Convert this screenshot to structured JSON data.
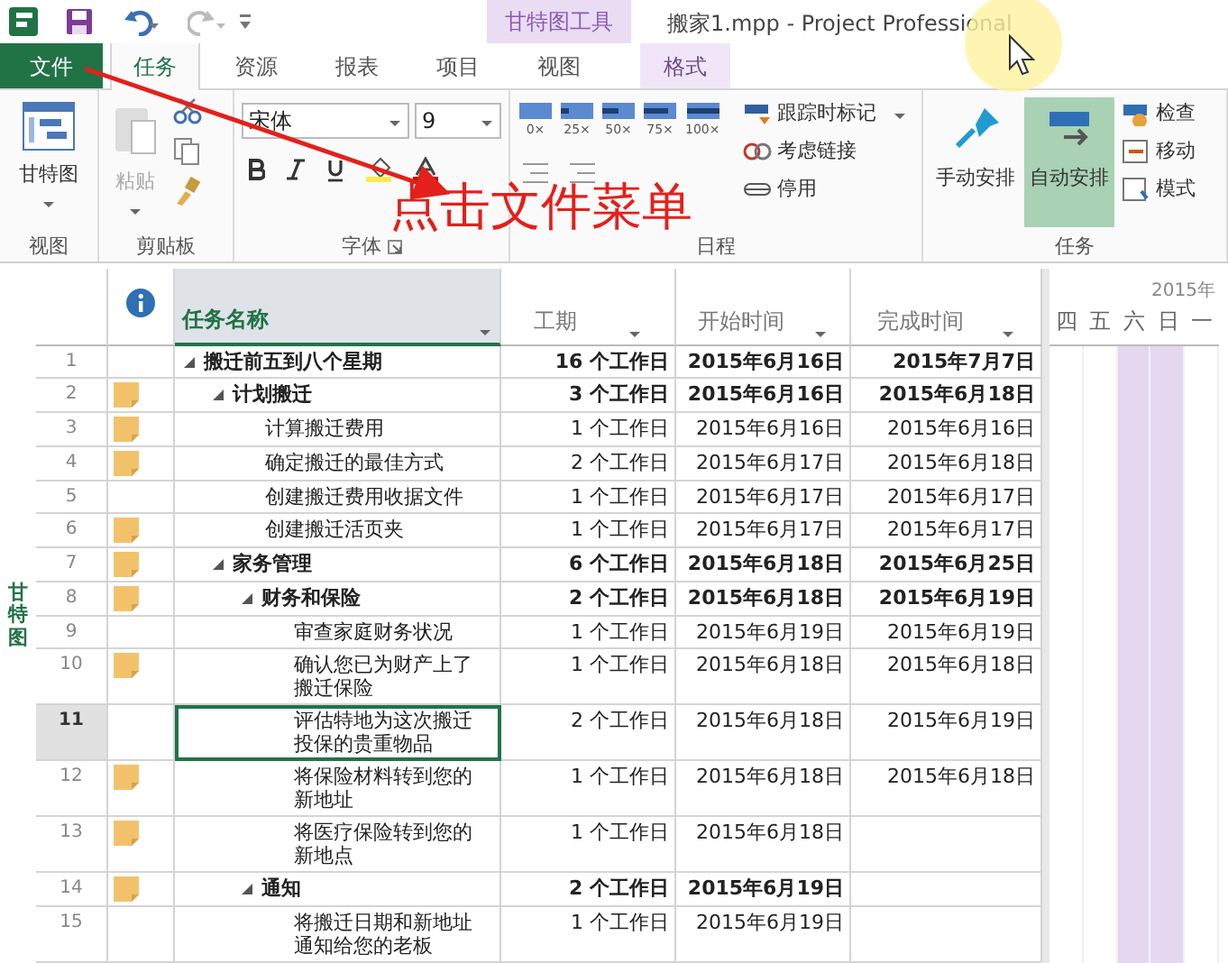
{
  "title_bar": {
    "title": "搬家1.mpp - Project Professional",
    "context_group": "甘特图工具"
  },
  "ribbon_tabs": [
    {
      "label": "文件",
      "kind": "file",
      "selected": false
    },
    {
      "label": "任务",
      "kind": "tab",
      "selected": true
    },
    {
      "label": "资源",
      "kind": "tab",
      "selected": false
    },
    {
      "label": "报表",
      "kind": "tab",
      "selected": false
    },
    {
      "label": "项目",
      "kind": "tab",
      "selected": false
    },
    {
      "label": "视图",
      "kind": "tab",
      "selected": false
    },
    {
      "label": "格式",
      "kind": "context",
      "selected": false
    }
  ],
  "ribbon": {
    "view_group": {
      "button": "甘特图",
      "label": "视图"
    },
    "clipboard_group": {
      "button": "粘贴",
      "disabled": true,
      "label": "剪贴板"
    },
    "font_group": {
      "font": "宋体",
      "size": "9",
      "label": "字体"
    },
    "schedule_group": {
      "zoom_presets": [
        "0×",
        "25×",
        "50×",
        "75×",
        "100×"
      ],
      "commands": [
        {
          "label": "跟踪时标记",
          "dropdown": true
        },
        {
          "label": "考虑链接",
          "dropdown": false
        },
        {
          "label": "停用",
          "dropdown": false
        }
      ],
      "label": "日程"
    },
    "tasks_group": {
      "modes": [
        {
          "label": "手动安排",
          "selected": false
        },
        {
          "label": "自动安排",
          "selected": true
        }
      ],
      "commands": [
        "检查",
        "移动",
        "模式"
      ],
      "label": "任务"
    }
  },
  "annotation": {
    "text": "点击文件菜单"
  },
  "side_label": "甘特图",
  "table": {
    "columns": [
      "任务名称",
      "工期",
      "开始时间",
      "完成时间"
    ],
    "rows": [
      {
        "id": "1",
        "note": false,
        "name": "搬迁前五到八个星期",
        "duration": "16 个工作日",
        "start": "2015年6月16日",
        "finish": "2015年7月7日",
        "selected": false,
        "children": [
          {
            "id": "2",
            "note": true,
            "name": "计划搬迁",
            "duration": "3 个工作日",
            "start": "2015年6月16日",
            "finish": "2015年6月18日",
            "selected": false,
            "children": [
              {
                "id": "3",
                "note": true,
                "name": "计算搬迁费用",
                "duration": "1 个工作日",
                "start": "2015年6月16日",
                "finish": "2015年6月16日",
                "selected": false
              },
              {
                "id": "4",
                "note": true,
                "name": "确定搬迁的最佳方式",
                "duration": "2 个工作日",
                "start": "2015年6月17日",
                "finish": "2015年6月18日",
                "selected": false
              },
              {
                "id": "5",
                "note": false,
                "name": "创建搬迁费用收据文件",
                "duration": "1 个工作日",
                "start": "2015年6月17日",
                "finish": "2015年6月17日",
                "selected": false
              },
              {
                "id": "6",
                "note": true,
                "name": "创建搬迁活页夹",
                "duration": "1 个工作日",
                "start": "2015年6月17日",
                "finish": "2015年6月17日",
                "selected": false
              }
            ]
          },
          {
            "id": "7",
            "note": true,
            "name": "家务管理",
            "duration": "6 个工作日",
            "start": "2015年6月18日",
            "finish": "2015年6月25日",
            "selected": false,
            "children": [
              {
                "id": "8",
                "note": true,
                "name": "财务和保险",
                "duration": "2 个工作日",
                "start": "2015年6月18日",
                "finish": "2015年6月19日",
                "selected": false,
                "children": [
                  {
                    "id": "9",
                    "note": false,
                    "name": "审查家庭财务状况",
                    "duration": "1 个工作日",
                    "start": "2015年6月19日",
                    "finish": "2015年6月19日",
                    "selected": false
                  },
                  {
                    "id": "10",
                    "note": true,
                    "name": "确认您已为财产上了搬迁保险",
                    "duration": "1 个工作日",
                    "start": "2015年6月18日",
                    "finish": "2015年6月18日",
                    "selected": false
                  },
                  {
                    "id": "11",
                    "note": false,
                    "name": "评估特地为这次搬迁投保的贵重物品",
                    "duration": "2 个工作日",
                    "start": "2015年6月18日",
                    "finish": "2015年6月19日",
                    "selected": true
                  },
                  {
                    "id": "12",
                    "note": true,
                    "name": "将保险材料转到您的新地址",
                    "duration": "1 个工作日",
                    "start": "2015年6月18日",
                    "finish": "2015年6月18日",
                    "selected": false
                  },
                  {
                    "id": "13",
                    "note": true,
                    "name": "将医疗保险转到您的新地点",
                    "duration": "1 个工作日",
                    "start": "2015年6月18日",
                    "selected": false
                  }
                ]
              },
              {
                "id": "14",
                "note": true,
                "name": "通知",
                "duration": "2 个工作日",
                "start": "2015年6月19日",
                "selected": false,
                "children": [
                  {
                    "id": "15",
                    "note": false,
                    "name": "将搬迁日期和新地址通知给您的老板",
                    "duration": "1 个工作日",
                    "start": "2015年6月19日",
                    "selected": false
                  }
                ]
              }
            ]
          }
        ]
      }
    ]
  },
  "gantt": {
    "year": "2015年",
    "days": [
      {
        "label": "四",
        "nonworking": false
      },
      {
        "label": "五",
        "nonworking": false
      },
      {
        "label": "六",
        "nonworking": true
      },
      {
        "label": "日",
        "nonworking": true
      },
      {
        "label": "一",
        "nonworking": false
      }
    ]
  }
}
